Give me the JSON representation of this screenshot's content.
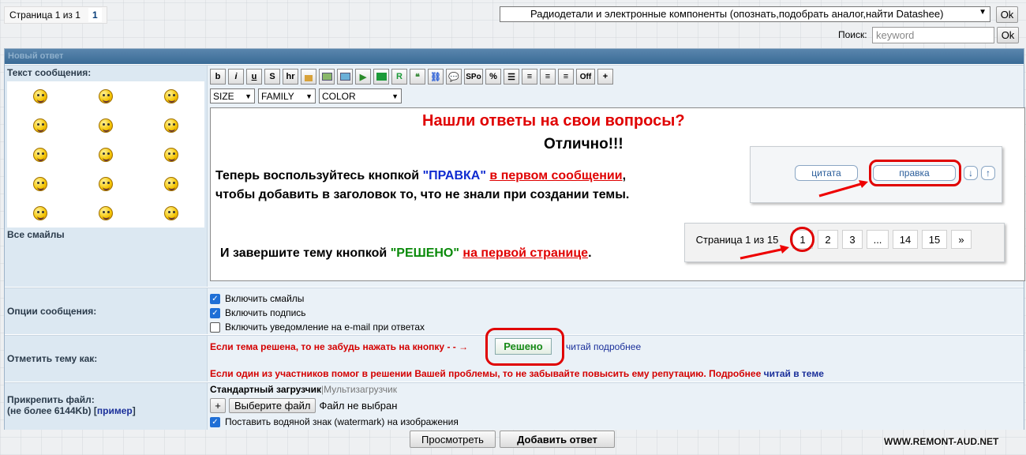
{
  "top": {
    "page_label": "Страница 1 из 1",
    "page_current": "1",
    "forum_select": "Радиодетали и электронные компоненты (опознать,подобрать аналог,найти Datashee)",
    "ok_label": "Ok",
    "search_label": "Поиск:",
    "search_placeholder": "keyword"
  },
  "form": {
    "header": "Новый ответ",
    "message_label": "Текст сообщения:",
    "all_smilies": "Все смайлы",
    "toolbar": [
      "b",
      "i",
      "u",
      "S",
      "hr",
      "",
      "",
      "",
      "",
      "",
      "R",
      "",
      "",
      "",
      "SPo",
      "%",
      "",
      "",
      "",
      "",
      "Off",
      "+"
    ],
    "selects": {
      "size": "SIZE",
      "family": "FAMILY",
      "color": "COLOR"
    },
    "editor": {
      "title": "Нашли ответы на свои вопросы?",
      "great": "Отлично!!!",
      "l1_a": "Теперь воспользуйтесь кнопкой ",
      "l1_b": "\"ПРАВКА\"",
      "l1_c": " ",
      "l1_d": "в первом сообщении",
      "l1_e": ",",
      "l2": "чтобы добавить в заголовок то, что не знали при создании темы.",
      "l3_a": "И завершите тему кнопкой ",
      "l3_b": "\"РЕШЕНО\"",
      "l3_c": " ",
      "l3_d": "на первой странице",
      "l3_e": ".",
      "shot_quote": "цитата",
      "shot_edit": "правка",
      "shot_pages": [
        "Страница 1 из 15",
        "1",
        "2",
        "3",
        "...",
        "14",
        "15",
        "»"
      ]
    },
    "options_label": "Опции сообщения:",
    "options": [
      {
        "label": "Включить смайлы",
        "checked": true
      },
      {
        "label": "Включить подпись",
        "checked": true
      },
      {
        "label": "Включить уведомление на e-mail при ответах",
        "checked": false
      }
    ],
    "mark_label": "Отметить тему как:",
    "mark_text1": "Если тема решена, то не забудь нажать на кнопку",
    "mark_button": "Решено",
    "mark_link": "читай подробнее",
    "mark_text2": "Если один из участников помог в решении Вашей проблемы, то не забывайте повысить ему репутацию. Подробнее",
    "mark_link2": "читай в теме",
    "attach_label1": "Прикрепить файл:",
    "attach_label2": "(не более 6144Kb) [",
    "attach_example": "пример",
    "attach_label3": "]",
    "uploader_std": "Стандартный загрузчик",
    "uploader_sep": "|",
    "uploader_multi": "Мультизагрузчик",
    "plus": "+",
    "choose_file": "Выберите файл",
    "no_file": "Файл не выбран",
    "watermark_opt": "Поставить водяной знак (watermark) на изображения",
    "preview": "Просмотреть",
    "submit": "Добавить ответ"
  },
  "watermark": "WWW.REMONT-AUD.NET"
}
